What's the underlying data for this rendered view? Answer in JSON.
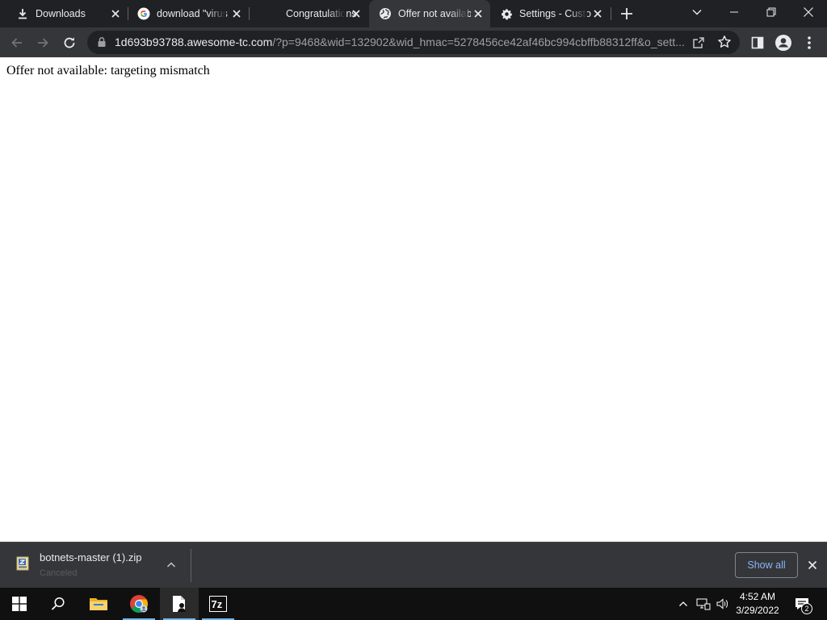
{
  "tabs": [
    {
      "title": "Downloads",
      "icon": "download-icon"
    },
    {
      "title": "download \"virus",
      "icon": "google-icon"
    },
    {
      "title": "Congratulations",
      "icon": "none"
    },
    {
      "title": "Offer not availab",
      "icon": "globe-icon",
      "active": true
    },
    {
      "title": "Settings - Custo",
      "icon": "gear-icon"
    }
  ],
  "address_bar": {
    "host": "1d693b93788.awesome-tc.com",
    "path": "/?p=9468&wid=132902&wid_hmac=5278456ce42af46bc994cbffb88312ff&o_sett..."
  },
  "page": {
    "message": "Offer not available: targeting mismatch"
  },
  "download_shelf": {
    "file_name": "botnets-master (1).zip",
    "status": "Canceled",
    "show_all_label": "Show all"
  },
  "taskbar": {
    "time": "4:52 AM",
    "date": "3/29/2022",
    "notification_count": "2",
    "apps": [
      "start-icon",
      "search-icon",
      "file-explorer-icon",
      "chrome-icon",
      "file-owner-icon",
      "7zip-icon"
    ]
  },
  "colors": {
    "tabstrip_bg": "#202124",
    "toolbar_bg": "#35363a",
    "link_blue": "#8ab4f8",
    "taskbar_bg": "#101010"
  }
}
